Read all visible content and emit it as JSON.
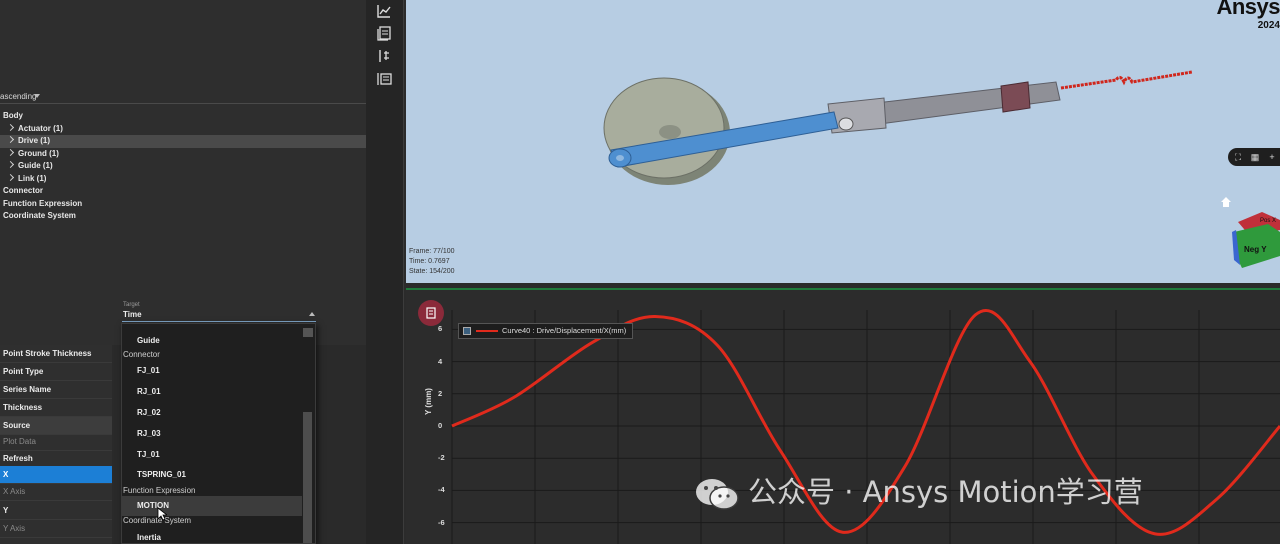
{
  "brand": {
    "name": "Ansys",
    "year": "2024"
  },
  "tree": {
    "sort_label": "ascending",
    "items": [
      {
        "label": "Body",
        "level": 0
      },
      {
        "label": "Actuator (1)",
        "level": 1
      },
      {
        "label": "Drive (1)",
        "level": 1,
        "selected": true
      },
      {
        "label": "Ground (1)",
        "level": 1
      },
      {
        "label": "Guide (1)",
        "level": 1
      },
      {
        "label": "Link (1)",
        "level": 1
      },
      {
        "label": "Connector",
        "level": 0
      },
      {
        "label": "Function Expression",
        "level": 0
      },
      {
        "label": "Coordinate System",
        "level": 0
      }
    ]
  },
  "toolbar": {
    "icons": [
      "chart-icon",
      "library-icon",
      "align-icon",
      "list-icon"
    ]
  },
  "target": {
    "label": "Target",
    "value": "Time"
  },
  "dropdown": {
    "items": [
      {
        "type": "item",
        "label": "Guide"
      },
      {
        "type": "group",
        "label": "Connector"
      },
      {
        "type": "item",
        "label": "FJ_01"
      },
      {
        "type": "item",
        "label": "RJ_01"
      },
      {
        "type": "item",
        "label": "RJ_02"
      },
      {
        "type": "item",
        "label": "RJ_03"
      },
      {
        "type": "item",
        "label": "TJ_01"
      },
      {
        "type": "item",
        "label": "TSPRING_01"
      },
      {
        "type": "group",
        "label": "Function Expression"
      },
      {
        "type": "item",
        "label": "MOTION",
        "highlighted": true
      },
      {
        "type": "group",
        "label": "Coordinate System"
      },
      {
        "type": "item",
        "label": "Inertia"
      }
    ]
  },
  "properties": {
    "rows": [
      {
        "label": "Point Stroke Thickness",
        "style": "normal"
      },
      {
        "label": "Point Type",
        "style": "normal"
      },
      {
        "label": "Series Name",
        "style": "normal"
      },
      {
        "label": "Thickness",
        "style": "normal"
      },
      {
        "label": "Source",
        "style": "hdr"
      },
      {
        "label": "Plot Data",
        "style": "dim"
      },
      {
        "label": "Refresh",
        "style": "normal"
      },
      {
        "label": "X",
        "style": "active"
      },
      {
        "label": "X Axis",
        "style": "dim"
      },
      {
        "label": "Y",
        "style": "normal"
      },
      {
        "label": "Y Axis",
        "style": "dim"
      }
    ]
  },
  "view3d": {
    "frame": "Frame: 77/100",
    "time": "Time: 0.7697",
    "state": "State: 154/200",
    "cube_top": "Pos X",
    "cube_face": "Neg Y"
  },
  "plot": {
    "legend": "Curve40 : Drive/Displacement/X(mm)",
    "ylabel": "Y (mm)",
    "yticks": [
      "6",
      "4",
      "2",
      "0",
      "-2",
      "-4",
      "-6"
    ],
    "line_color": "#e02a1c"
  },
  "chart_data": {
    "type": "line",
    "ylabel": "Y (mm)",
    "ylim": [
      -7,
      7
    ],
    "yticks": [
      6,
      4,
      2,
      0,
      -2,
      -4,
      -6
    ],
    "grid": true,
    "series": [
      {
        "name": "Curve40 : Drive/Displacement/X(mm)",
        "color": "#e02a1c",
        "x": [
          0,
          0.4,
          0.9,
          1.3,
          1.7,
          2.1,
          2.5,
          2.9,
          3.35,
          3.7,
          4.1,
          4.5,
          4.9,
          5.3
        ],
        "y": [
          0,
          1.8,
          5.2,
          6.8,
          5.0,
          -1.5,
          -6.6,
          -2.5,
          6.9,
          4.0,
          -3.0,
          -6.7,
          -4.5,
          0
        ]
      }
    ]
  },
  "watermark": "公众号 · Ansys Motion学习营"
}
